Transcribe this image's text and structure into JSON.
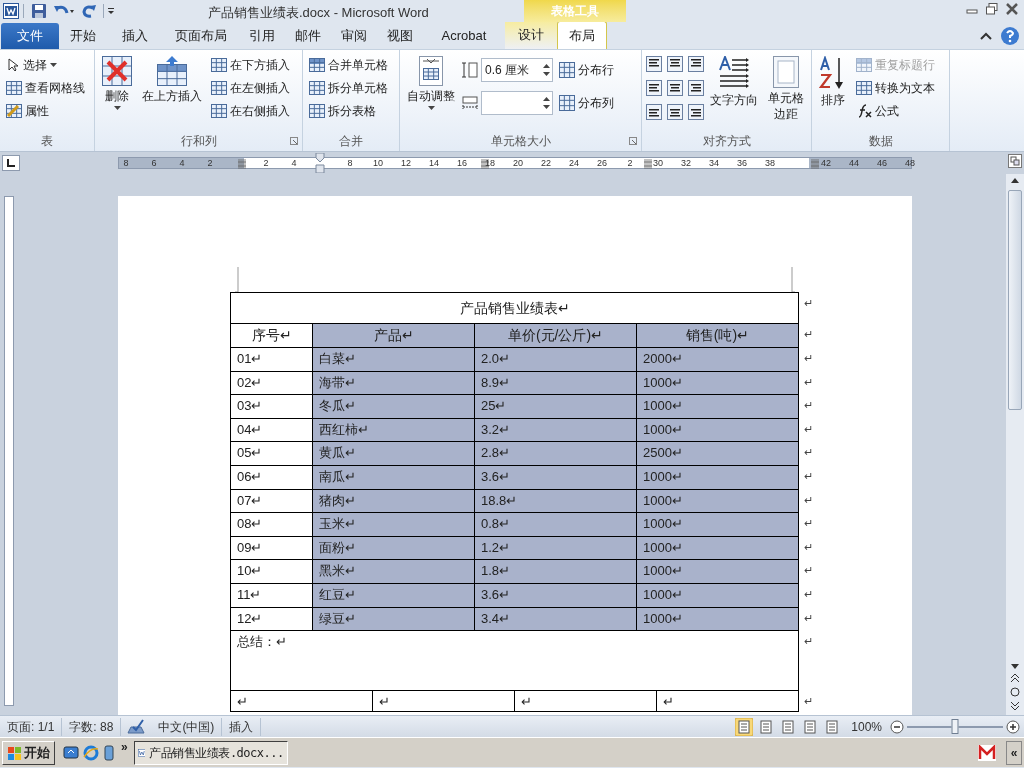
{
  "window": {
    "title": "产品销售业绩表.docx - Microsoft Word",
    "contextual_title": "表格工具"
  },
  "tabs": [
    {
      "label": "文件",
      "kind": "file",
      "selected": false
    },
    {
      "label": "开始",
      "kind": "normal",
      "selected": false
    },
    {
      "label": "插入",
      "kind": "normal",
      "selected": false
    },
    {
      "label": "页面布局",
      "kind": "normal",
      "selected": false
    },
    {
      "label": "引用",
      "kind": "normal",
      "selected": false
    },
    {
      "label": "邮件",
      "kind": "normal",
      "selected": false
    },
    {
      "label": "审阅",
      "kind": "normal",
      "selected": false
    },
    {
      "label": "视图",
      "kind": "normal",
      "selected": false
    },
    {
      "label": "Acrobat",
      "kind": "normal",
      "selected": false
    },
    {
      "label": "设计",
      "kind": "contextual",
      "selected": false
    },
    {
      "label": "布局",
      "kind": "contextual",
      "selected": true
    }
  ],
  "ribbon_groups": [
    {
      "title": "表",
      "columns": [
        [
          {
            "kind": "small",
            "label": "选择",
            "dropdown": true,
            "disabled": false
          },
          {
            "kind": "small",
            "label": "查看网格线",
            "dropdown": false,
            "disabled": false
          },
          {
            "kind": "small",
            "label": "属性",
            "dropdown": false,
            "disabled": false
          }
        ]
      ]
    },
    {
      "title": "行和列",
      "columns": [
        [
          {
            "kind": "large",
            "label": "删除",
            "dropdown": true,
            "disabled": false
          }
        ],
        [
          {
            "kind": "large",
            "label": "在上方插入",
            "dropdown": false,
            "disabled": false
          }
        ],
        [
          {
            "kind": "small",
            "label": "在下方插入",
            "dropdown": false,
            "disabled": false
          },
          {
            "kind": "small",
            "label": "在左侧插入",
            "dropdown": false,
            "disabled": false
          },
          {
            "kind": "small",
            "label": "在右侧插入",
            "dropdown": false,
            "disabled": false
          }
        ]
      ]
    },
    {
      "title": "合并",
      "columns": [
        [
          {
            "kind": "small",
            "label": "合并单元格",
            "dropdown": false,
            "disabled": false
          },
          {
            "kind": "small",
            "label": "拆分单元格",
            "dropdown": false,
            "disabled": false
          },
          {
            "kind": "small",
            "label": "拆分表格",
            "dropdown": false,
            "disabled": false
          }
        ]
      ]
    },
    {
      "title": "单元格大小",
      "columns": [
        [
          {
            "kind": "large",
            "label": "自动调整",
            "dropdown": true,
            "disabled": false
          }
        ],
        [
          {
            "kind": "spin",
            "value": "0.6 厘米"
          },
          {
            "kind": "spin"
          }
        ],
        [
          {
            "kind": "small",
            "label": "分布行",
            "dropdown": false,
            "disabled": false
          },
          {
            "kind": "small",
            "label": "分布列",
            "dropdown": false,
            "disabled": false
          }
        ]
      ]
    },
    {
      "title": "对齐方式",
      "columns": [
        [
          {
            "kind": "align_grid"
          }
        ],
        [
          {
            "kind": "large",
            "label": "文字方向",
            "dropdown": false,
            "disabled": false
          }
        ],
        [
          {
            "kind": "large",
            "label": "单元格边距",
            "dropdown": false,
            "disabled": false
          }
        ]
      ]
    },
    {
      "title": "数据",
      "columns": [
        [
          {
            "kind": "large",
            "label": "排序",
            "dropdown": false,
            "disabled": false
          }
        ],
        [
          {
            "kind": "small",
            "label": "重复标题行",
            "dropdown": false,
            "disabled": true
          },
          {
            "kind": "small",
            "label": "转换为文本",
            "dropdown": false,
            "disabled": false
          },
          {
            "kind": "small",
            "label": "公式",
            "dropdown": false,
            "disabled": false
          }
        ]
      ]
    }
  ],
  "ruler": {
    "labels": [
      "8",
      "6",
      "4",
      "2",
      "2",
      "4",
      "8",
      "10",
      "12",
      "14",
      "16",
      "18",
      "20",
      "22",
      "24",
      "26",
      "2",
      "30",
      "32",
      "34",
      "36",
      "38",
      "42",
      "44",
      "46",
      "48"
    ]
  },
  "document": {
    "table": {
      "title": "产品销售业绩表↵",
      "title_end": "↵",
      "columns": [
        {
          "header": "序号↵",
          "shaded": false
        },
        {
          "header": "产品↵",
          "shaded": true
        },
        {
          "header": "单价(元/公斤)↵",
          "shaded": true
        },
        {
          "header": "销售(吨)↵",
          "shaded": true
        }
      ],
      "header_end": "↵",
      "rows": [
        {
          "cells": [
            "01↵",
            "白菜↵",
            "2.0↵",
            "2000↵"
          ],
          "end": "↵"
        },
        {
          "cells": [
            "02↵",
            "海带↵",
            "8.9↵",
            "1000↵"
          ],
          "end": "↵"
        },
        {
          "cells": [
            "03↵",
            "冬瓜↵",
            "25↵",
            "1000↵"
          ],
          "end": "↵"
        },
        {
          "cells": [
            "04↵",
            "西红柿↵",
            "3.2↵",
            "1000↵"
          ],
          "end": "↵"
        },
        {
          "cells": [
            "05↵",
            "黄瓜↵",
            "2.8↵",
            "2500↵"
          ],
          "end": "↵"
        },
        {
          "cells": [
            "06↵",
            "南瓜↵",
            "3.6↵",
            "1000↵"
          ],
          "end": "↵"
        },
        {
          "cells": [
            "07↵",
            "猪肉↵",
            "18.8↵",
            "1000↵"
          ],
          "end": "↵"
        },
        {
          "cells": [
            "08↵",
            "玉米↵",
            "0.8↵",
            "1000↵"
          ],
          "end": "↵"
        },
        {
          "cells": [
            "09↵",
            "面粉↵",
            "1.2↵",
            "1000↵"
          ],
          "end": "↵"
        },
        {
          "cells": [
            "10↵",
            "黑米↵",
            "1.8↵",
            "1000↵"
          ],
          "end": "↵"
        },
        {
          "cells": [
            "11↵",
            "红豆↵",
            "3.6↵",
            "1000↵"
          ],
          "end": "↵"
        },
        {
          "cells": [
            "12↵",
            "绿豆↵",
            "3.4↵",
            "1000↵"
          ],
          "end": "↵"
        }
      ],
      "summary": "总结：↵",
      "summary_end": "↵",
      "footer_cells": [
        "↵",
        "↵",
        "↵",
        "↵"
      ],
      "footer_end": "↵"
    }
  },
  "status_bar": {
    "items": [
      "页面: 1/1",
      "字数: 88",
      "中文(中国)",
      "插入"
    ],
    "zoom": "100%",
    "zoom_level": {
      "level": 0.5
    }
  },
  "taskbar": {
    "start": "开始",
    "more": "»",
    "window": "产品销售业绩表.docx...",
    "tray": "«"
  }
}
